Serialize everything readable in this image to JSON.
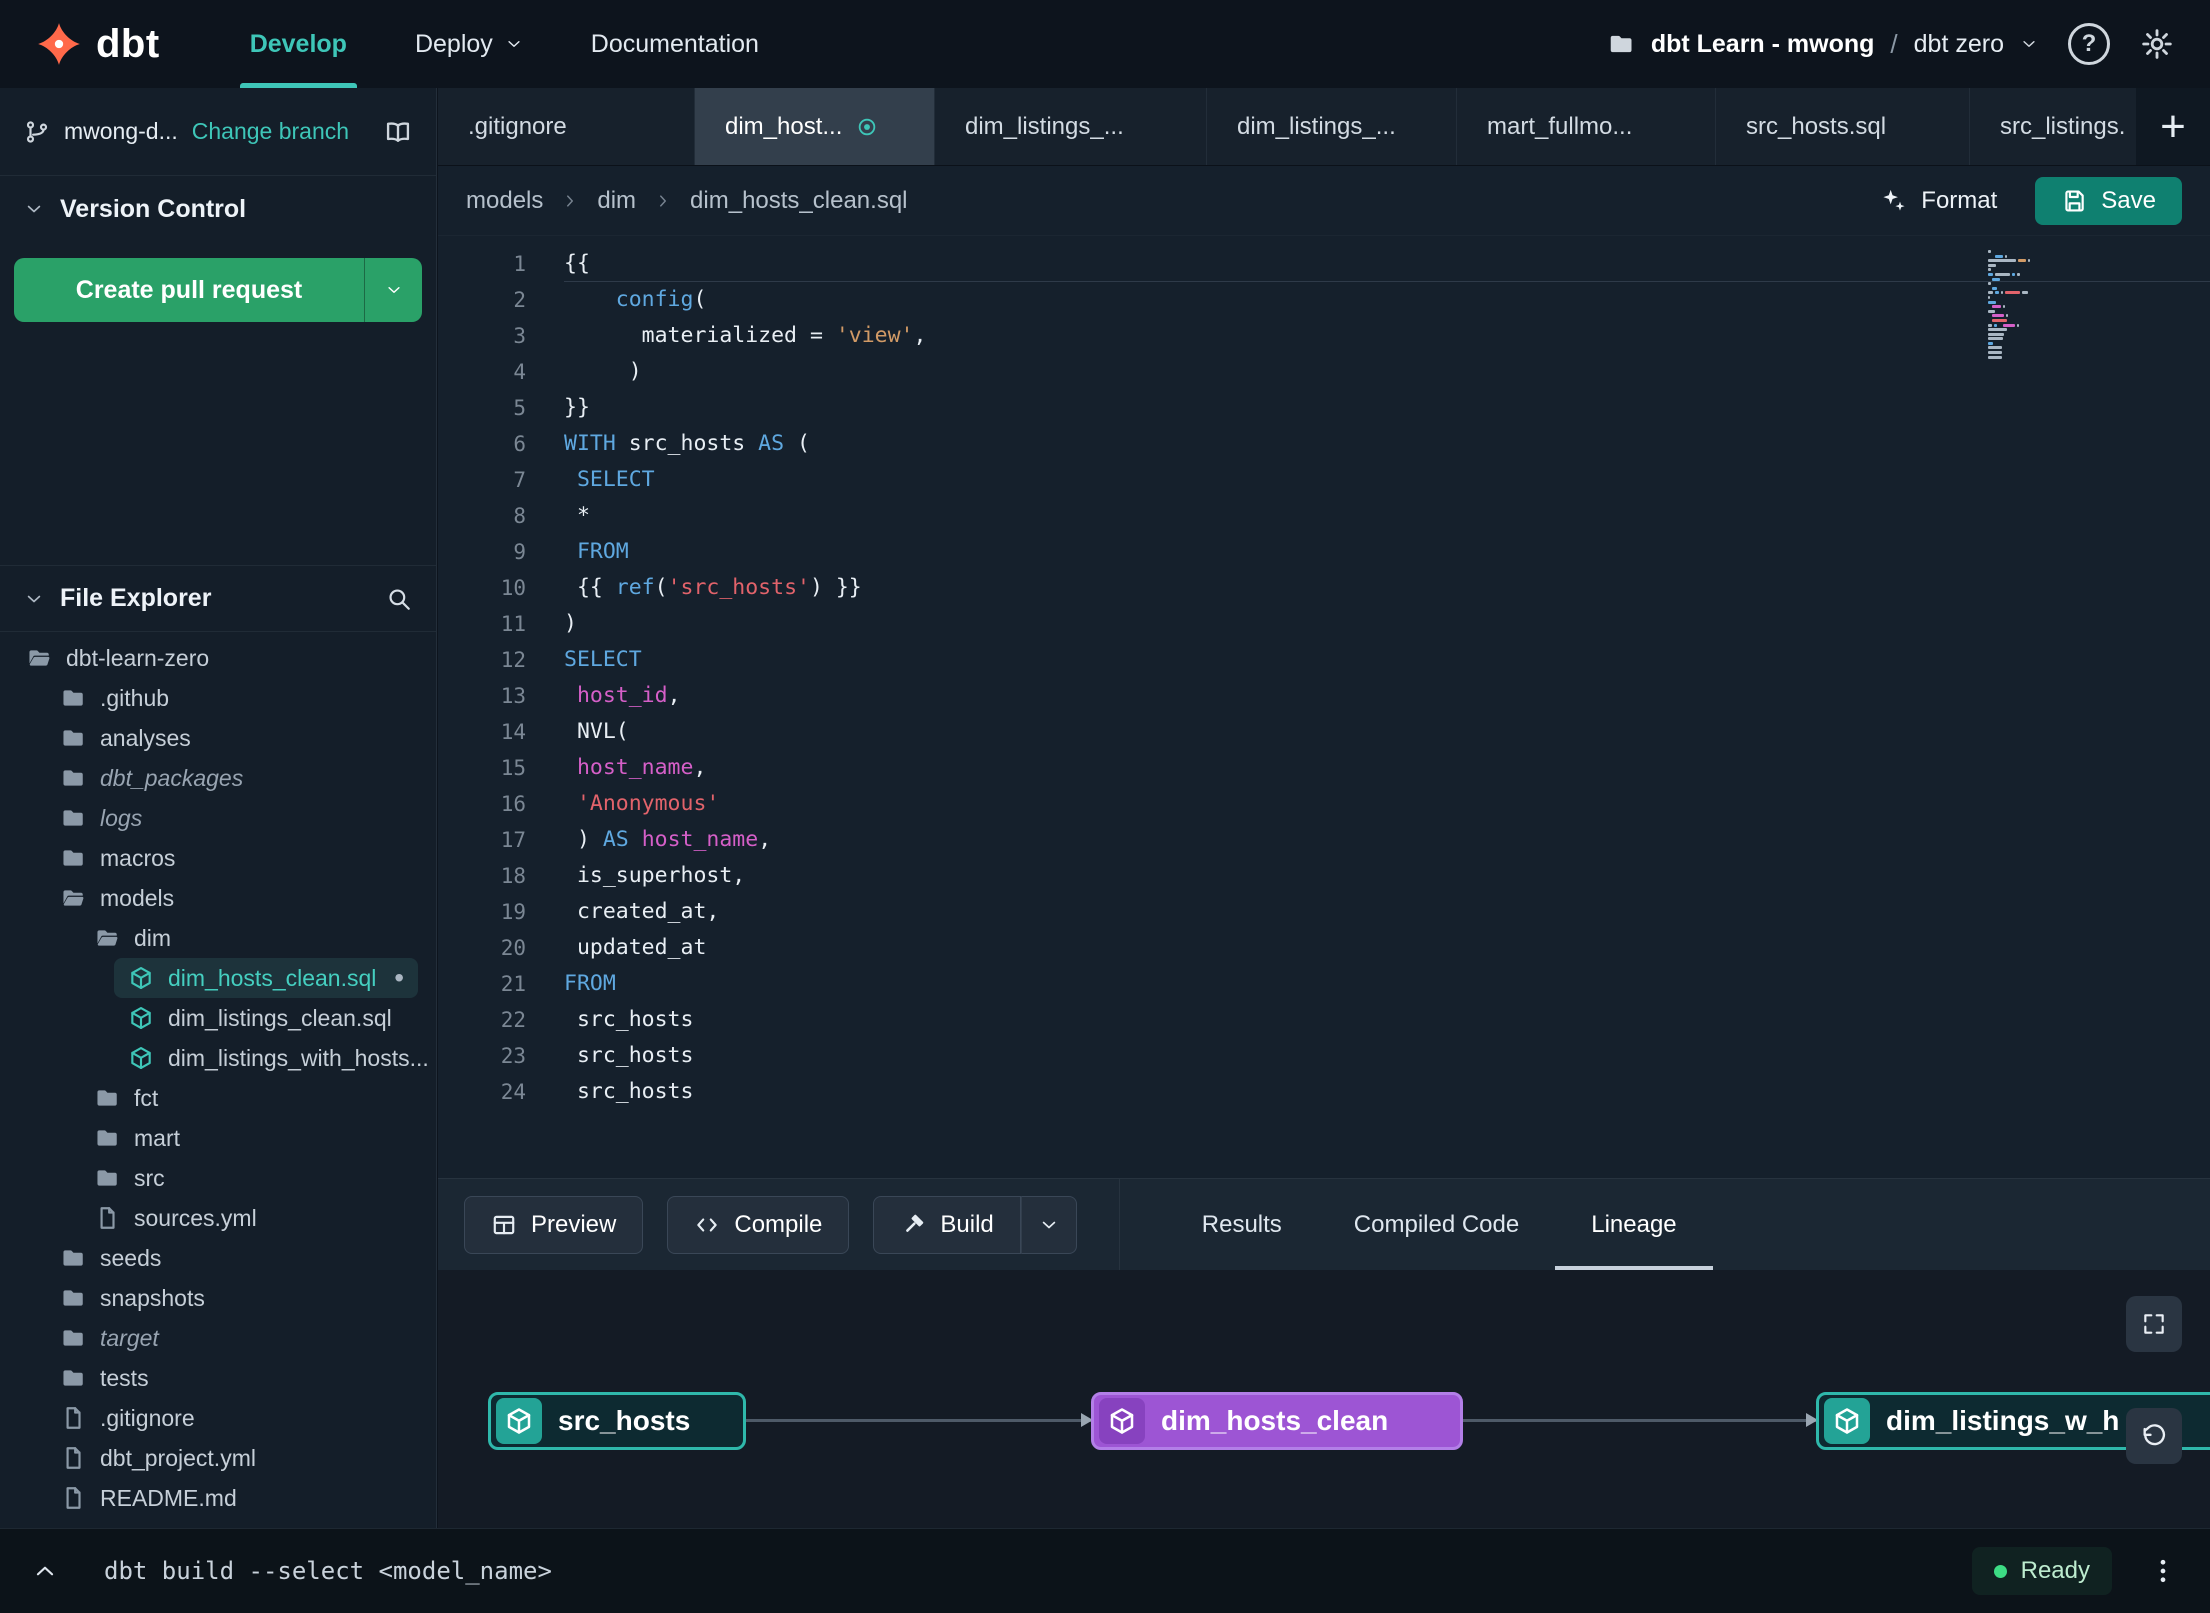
{
  "navbar": {
    "logo": "dbt",
    "nav": [
      {
        "label": "Develop",
        "active": true
      },
      {
        "label": "Deploy",
        "chevron": true
      },
      {
        "label": "Documentation"
      }
    ],
    "account": "dbt Learn - mwong",
    "separator": "/",
    "project": "dbt zero"
  },
  "sidebar": {
    "branch": {
      "name": "mwong-d...",
      "change": "Change branch"
    },
    "version_control": {
      "title": "Version Control",
      "create_pr": "Create pull request"
    },
    "file_explorer": {
      "title": "File Explorer"
    },
    "tree": [
      {
        "label": "dbt-learn-zero",
        "icon": "folder-open-icon",
        "level": 0
      },
      {
        "label": ".github",
        "icon": "folder-icon",
        "level": 1
      },
      {
        "label": "analyses",
        "icon": "folder-icon",
        "level": 1
      },
      {
        "label": "dbt_packages",
        "icon": "folder-icon",
        "level": 1,
        "italic": true
      },
      {
        "label": "logs",
        "icon": "folder-icon",
        "level": 1,
        "italic": true
      },
      {
        "label": "macros",
        "icon": "folder-icon",
        "level": 1
      },
      {
        "label": "models",
        "icon": "folder-open-icon",
        "level": 1
      },
      {
        "label": "dim",
        "icon": "folder-open-icon",
        "level": 2
      },
      {
        "label": "dim_hosts_clean.sql",
        "icon": "model-icon",
        "level": 3,
        "selected": true,
        "modified": true
      },
      {
        "label": "dim_listings_clean.sql",
        "icon": "model-icon",
        "level": 3
      },
      {
        "label": "dim_listings_with_hosts...",
        "icon": "model-icon",
        "level": 3
      },
      {
        "label": "fct",
        "icon": "folder-icon",
        "level": 2
      },
      {
        "label": "mart",
        "icon": "folder-icon",
        "level": 2
      },
      {
        "label": "src",
        "icon": "folder-icon",
        "level": 2
      },
      {
        "label": "sources.yml",
        "icon": "file-icon",
        "level": 2
      },
      {
        "label": "seeds",
        "icon": "folder-icon",
        "level": 1
      },
      {
        "label": "snapshots",
        "icon": "folder-icon",
        "level": 1
      },
      {
        "label": "target",
        "icon": "folder-icon",
        "level": 1,
        "italic": true
      },
      {
        "label": "tests",
        "icon": "folder-icon",
        "level": 1
      },
      {
        "label": ".gitignore",
        "icon": "file-icon",
        "level": 1
      },
      {
        "label": "dbt_project.yml",
        "icon": "file-icon",
        "level": 1
      },
      {
        "label": "README.md",
        "icon": "file-icon",
        "level": 1
      }
    ]
  },
  "tabs": [
    {
      "label": ".gitignore"
    },
    {
      "label": "dim_host...",
      "active": true,
      "modified": true
    },
    {
      "label": "dim_listings_..."
    },
    {
      "label": "dim_listings_..."
    },
    {
      "label": "mart_fullmo..."
    },
    {
      "label": "src_hosts.sql"
    },
    {
      "label": "src_listings."
    }
  ],
  "breadcrumb": [
    "models",
    "dim",
    "dim_hosts_clean.sql"
  ],
  "editor": {
    "format": "Format",
    "save": "Save",
    "code": [
      {
        "n": 1,
        "t": [
          [
            "p",
            "{{"
          ]
        ]
      },
      {
        "n": 2,
        "t": [
          [
            "p",
            "    "
          ],
          [
            "fn",
            "config"
          ],
          [
            "p",
            "("
          ]
        ]
      },
      {
        "n": 3,
        "t": [
          [
            "p",
            "      materialized = "
          ],
          [
            "so",
            "'view'"
          ],
          [
            "p",
            ","
          ]
        ]
      },
      {
        "n": 4,
        "t": [
          [
            "p",
            "     )"
          ]
        ]
      },
      {
        "n": 5,
        "t": [
          [
            "p",
            "}}"
          ]
        ]
      },
      {
        "n": 6,
        "t": [
          [
            "kw",
            "WITH"
          ],
          [
            "p",
            " src_hosts "
          ],
          [
            "kw",
            "AS"
          ],
          [
            "p",
            " ("
          ]
        ]
      },
      {
        "n": 7,
        "t": [
          [
            "p",
            " "
          ],
          [
            "kw",
            "SELECT"
          ]
        ]
      },
      {
        "n": 8,
        "t": [
          [
            "p",
            " *"
          ]
        ]
      },
      {
        "n": 9,
        "t": [
          [
            "p",
            " "
          ],
          [
            "kw",
            "FROM"
          ]
        ]
      },
      {
        "n": 10,
        "t": [
          [
            "p",
            " {{ "
          ],
          [
            "fn",
            "ref"
          ],
          [
            "p",
            "("
          ],
          [
            "sr",
            "'src_hosts'"
          ],
          [
            "p",
            ") }}"
          ]
        ]
      },
      {
        "n": 11,
        "t": [
          [
            "p",
            ")"
          ]
        ]
      },
      {
        "n": 12,
        "t": [
          [
            "kw",
            "SELECT"
          ]
        ]
      },
      {
        "n": 13,
        "t": [
          [
            "p",
            " "
          ],
          [
            "id",
            "host_id"
          ],
          [
            "p",
            ","
          ]
        ]
      },
      {
        "n": 14,
        "t": [
          [
            "p",
            " NVL("
          ]
        ]
      },
      {
        "n": 15,
        "t": [
          [
            "p",
            " "
          ],
          [
            "id",
            "host_name"
          ],
          [
            "p",
            ","
          ]
        ]
      },
      {
        "n": 16,
        "t": [
          [
            "p",
            " "
          ],
          [
            "sr",
            "'Anonymous'"
          ]
        ]
      },
      {
        "n": 17,
        "t": [
          [
            "p",
            " ) "
          ],
          [
            "kw",
            "AS"
          ],
          [
            "p",
            " "
          ],
          [
            "id",
            "host_name"
          ],
          [
            "p",
            ","
          ]
        ]
      },
      {
        "n": 18,
        "t": [
          [
            "p",
            " is_superhost,"
          ]
        ]
      },
      {
        "n": 19,
        "t": [
          [
            "p",
            " created_at,"
          ]
        ]
      },
      {
        "n": 20,
        "t": [
          [
            "p",
            " updated_at"
          ]
        ]
      },
      {
        "n": 21,
        "t": [
          [
            "kw",
            "FROM"
          ]
        ]
      },
      {
        "n": 22,
        "t": [
          [
            "p",
            " src_hosts"
          ]
        ]
      },
      {
        "n": 23,
        "t": [
          [
            "p",
            " src_hosts"
          ]
        ]
      },
      {
        "n": 24,
        "t": [
          [
            "p",
            " src_hosts"
          ]
        ]
      }
    ]
  },
  "action_bar": {
    "preview": "Preview",
    "compile": "Compile",
    "build": "Build",
    "tabs": [
      {
        "label": "Results"
      },
      {
        "label": "Compiled Code"
      },
      {
        "label": "Lineage",
        "active": true
      }
    ]
  },
  "lineage": {
    "nodes": [
      {
        "label": "src_hosts",
        "color": "teal"
      },
      {
        "label": "dim_hosts_clean",
        "color": "purple"
      },
      {
        "label": "dim_listings_w_h",
        "color": "teal"
      }
    ]
  },
  "status_bar": {
    "command": "dbt build --select <model_name>",
    "ready": "Ready"
  },
  "colors": {
    "accent_teal": "#3ec6b8",
    "brand_orange": "#ff694a",
    "pr_green": "#2aa168",
    "save_teal": "#0f8070",
    "node_purple": "#9d55d4",
    "ready_green": "#3ddc84"
  }
}
